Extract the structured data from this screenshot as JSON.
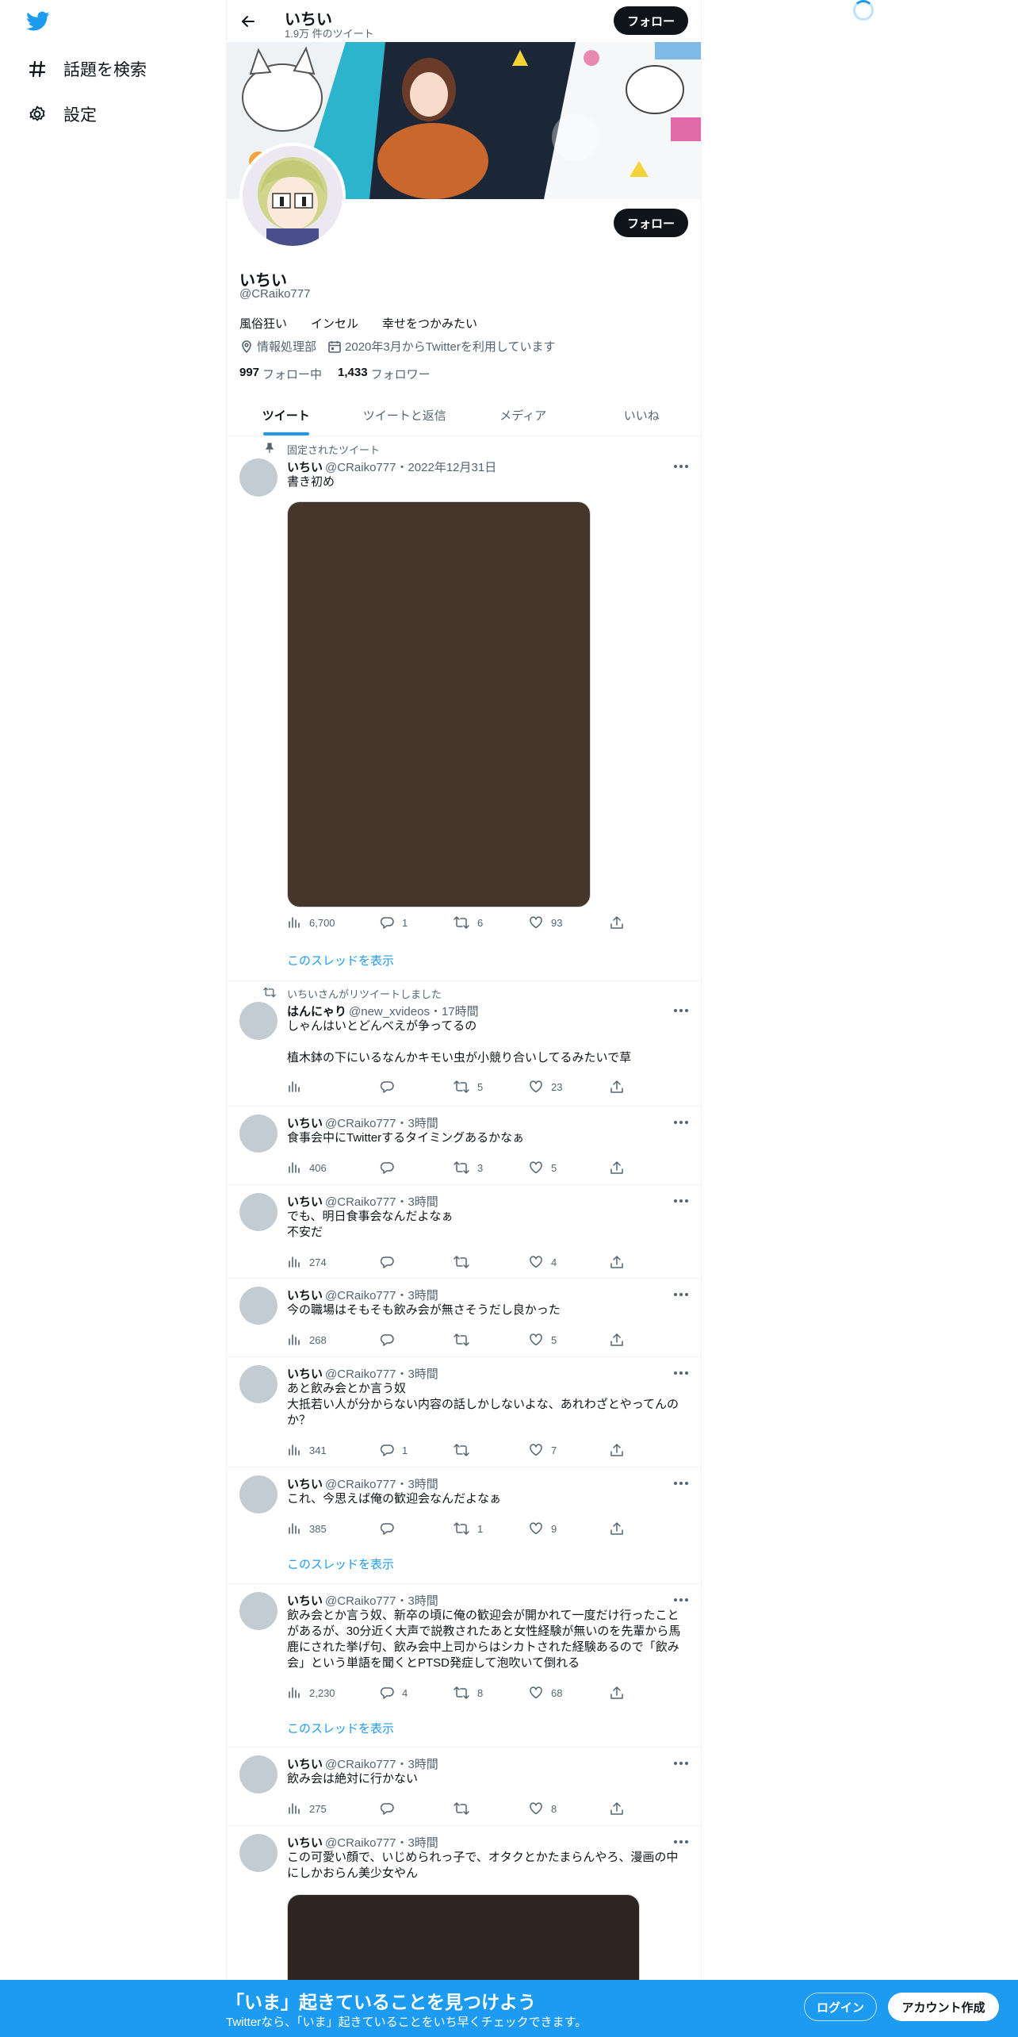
{
  "nav": {
    "items": [
      {
        "label": "話題を検索",
        "icon": "hashtag-icon"
      },
      {
        "label": "設定",
        "icon": "gear-icon"
      }
    ]
  },
  "header": {
    "name": "いちい",
    "tweet_count": "1.9万 件のツイート",
    "follow_label": "フォロー"
  },
  "profile": {
    "name": "いちい",
    "handle": "@CRaiko777",
    "bio": "風俗狂い　　インセル　　幸せをつかみたい",
    "location": "情報処理部",
    "joined": "2020年3月からTwitterを利用しています",
    "following_count": "997",
    "following_label": "フォロー中",
    "followers_count": "1,433",
    "followers_label": "フォロワー",
    "follow_label": "フォロー"
  },
  "tabs": [
    {
      "label": "ツイート",
      "active": true
    },
    {
      "label": "ツイートと返信",
      "active": false
    },
    {
      "label": "メディア",
      "active": false
    },
    {
      "label": "いいね",
      "active": false
    }
  ],
  "tweets": [
    {
      "context": "固定されたツイート",
      "name": "いちい",
      "meta": "@CRaiko777・2022年12月31日",
      "text": "書き初め",
      "views": "6,700",
      "replies": "1",
      "retweets": "6",
      "likes": "93",
      "thread": "このスレッドを表示"
    },
    {
      "context": "いちいさんがリツイートしました",
      "name": "はんにゃり",
      "meta": "@new_xvideos・17時間",
      "text": "しゃんはいとどんべえが争ってるの\n\n植木鉢の下にいるなんかキモい虫が小競り合いしてるみたいで草",
      "views": "",
      "replies": "",
      "retweets": "5",
      "likes": "23"
    },
    {
      "name": "いちい",
      "meta": "@CRaiko777・3時間",
      "text": "食事会中にTwitterするタイミングあるかなぁ",
      "views": "406",
      "replies": "",
      "retweets": "3",
      "likes": "5"
    },
    {
      "name": "いちい",
      "meta": "@CRaiko777・3時間",
      "text": "でも、明日食事会なんだよなぁ\n不安だ",
      "views": "274",
      "replies": "",
      "retweets": "",
      "likes": "4"
    },
    {
      "name": "いちい",
      "meta": "@CRaiko777・3時間",
      "text": "今の職場はそもそも飲み会が無さそうだし良かった",
      "views": "268",
      "replies": "",
      "retweets": "",
      "likes": "5"
    },
    {
      "name": "いちい",
      "meta": "@CRaiko777・3時間",
      "text": "あと飲み会とか言う奴\n大抵若い人が分からない内容の話しかしないよな、あれわざとやってんのか？",
      "views": "341",
      "replies": "1",
      "retweets": "",
      "likes": "7"
    },
    {
      "name": "いちい",
      "meta": "@CRaiko777・3時間",
      "text": "これ、今思えば俺の歓迎会なんだよなぁ",
      "views": "385",
      "replies": "",
      "retweets": "1",
      "likes": "9",
      "thread": "このスレッドを表示"
    },
    {
      "name": "いちい",
      "meta": "@CRaiko777・3時間",
      "text": "飲み会とか言う奴、新卒の頃に俺の歓迎会が開かれて一度だけ行ったことがあるが、30分近く大声で説教されたあと女性経験が無いのを先輩から馬鹿にされた挙げ句、飲み会中上司からはシカトされた経験あるので「飲み会」という単語を聞くとPTSD発症して泡吹いて倒れる",
      "views": "2,230",
      "replies": "4",
      "retweets": "8",
      "likes": "68",
      "thread": "このスレッドを表示"
    },
    {
      "name": "いちい",
      "meta": "@CRaiko777・3時間",
      "text": "飲み会は絶対に行かない",
      "views": "275",
      "replies": "",
      "retweets": "",
      "likes": "8"
    },
    {
      "name": "いちい",
      "meta": "@CRaiko777・3時間",
      "text": "この可愛い顔で、いじめられっ子で、オタクとかたまらんやろ、漫画の中にしかおらん美少女やん"
    }
  ],
  "bottom": {
    "title": "「いま」起きていることを見つけよう",
    "subtitle": "Twitterなら、「いま」起きていることをいち早くチェックできます。",
    "login": "ログイン",
    "signup": "アカウント作成"
  },
  "colors": {
    "accent": "#1d9bf0",
    "text": "#0f1419",
    "muted": "#536471",
    "media": "#46352b"
  }
}
